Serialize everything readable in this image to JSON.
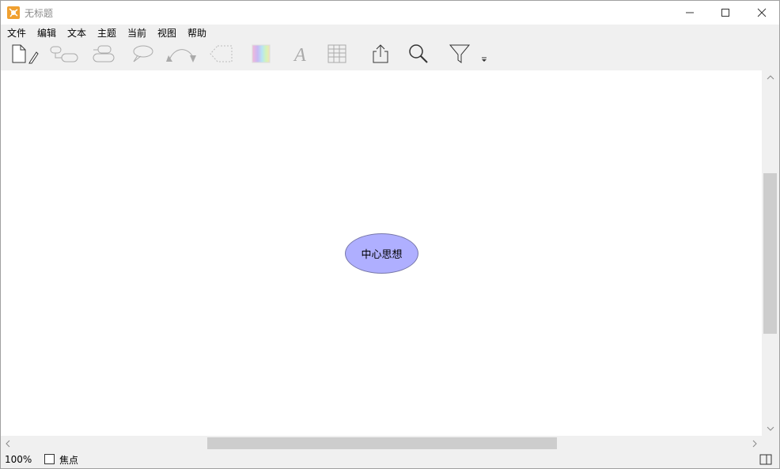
{
  "window": {
    "title": "无标题",
    "minimize_icon": "minimize-icon",
    "maximize_icon": "maximize-icon",
    "close_icon": "close-icon"
  },
  "menu": {
    "items": [
      "文件",
      "编辑",
      "文本",
      "主题",
      "当前",
      "视图",
      "帮助"
    ]
  },
  "toolbar": {
    "icons": [
      "new-document-icon",
      "add-subtopic-icon",
      "add-sibling-icon",
      "callout-icon",
      "relationship-icon",
      "boundary-icon",
      "color-icon",
      "font-icon",
      "table-icon",
      "export-icon",
      "search-icon",
      "filter-icon",
      "overflow-icon"
    ]
  },
  "canvas": {
    "central_topic": "中心思想",
    "node_fill": "#afafff"
  },
  "status": {
    "zoom": "100%",
    "focus_label": "焦点",
    "focus_checked": false
  }
}
